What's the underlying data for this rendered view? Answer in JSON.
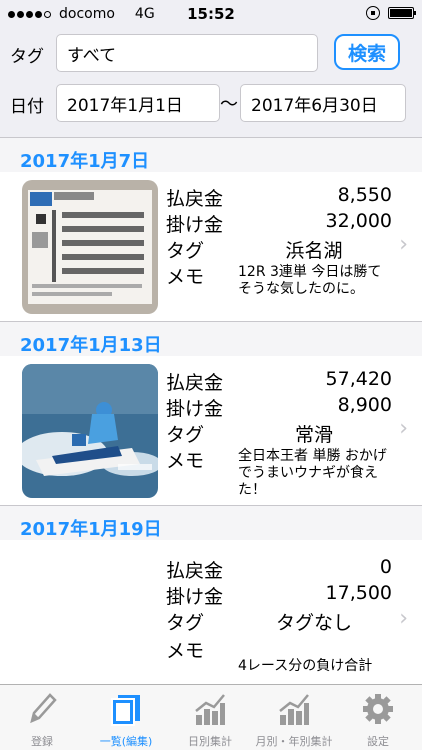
{
  "status": {
    "carrier": "docomo",
    "network": "4G",
    "time": "15:52"
  },
  "filters": {
    "tag_label": "タグ",
    "tag_value": "すべて",
    "search_label": "検索",
    "date_label": "日付",
    "date_from": "2017年1月1日",
    "range_sep": "〜",
    "date_to": "2017年6月30日"
  },
  "labels": {
    "payout": "払戻金",
    "bet": "掛け金",
    "tag": "タグ",
    "memo": "メモ"
  },
  "entries": [
    {
      "date": "2017年1月7日",
      "payout": "8,550",
      "bet": "32,000",
      "tag": "浜名湖",
      "memo": "12R 3連単 今日は勝てそうな気したのに。",
      "thumb": "ticket-photo"
    },
    {
      "date": "2017年1月13日",
      "payout": "57,420",
      "bet": "8,900",
      "tag": "常滑",
      "memo": "全日本王者 単勝 おかげでうまいウナギが食えた！",
      "thumb": "boat-photo"
    },
    {
      "date": "2017年1月19日",
      "payout": "0",
      "bet": "17,500",
      "tag": "タグなし",
      "memo": "4レース分の負け合計",
      "thumb": ""
    }
  ],
  "tabs": [
    {
      "label": "登録",
      "icon": "pencil-icon",
      "active": false
    },
    {
      "label": "一覧(編集)",
      "icon": "list-icon",
      "active": true
    },
    {
      "label": "日別集計",
      "icon": "chart-icon",
      "active": false
    },
    {
      "label": "月別・年別集計",
      "icon": "chart-icon",
      "active": false
    },
    {
      "label": "設定",
      "icon": "gear-icon",
      "active": false
    }
  ],
  "colors": {
    "accent": "#1e90ff",
    "background": "#efeff4"
  }
}
